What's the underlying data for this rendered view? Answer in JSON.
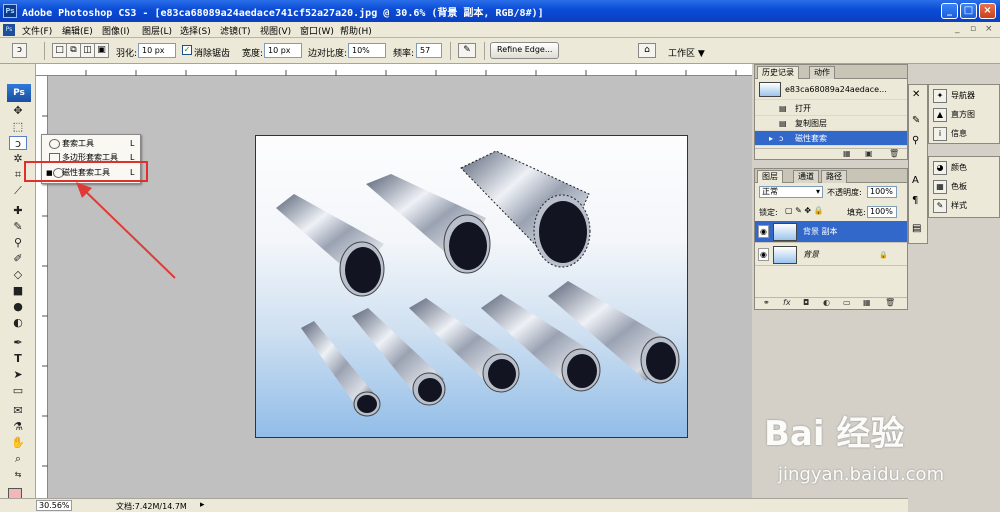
{
  "title": "Adobe Photoshop CS3 - [e83ca68089a24aedace741cf52a27a20.jpg @ 30.6% (背景 副本, RGB/8#)]",
  "ps_logo": "Ps",
  "menu": [
    "文件(F)",
    "编辑(E)",
    "图像(I)",
    "图层(L)",
    "选择(S)",
    "滤镜(T)",
    "视图(V)",
    "窗口(W)",
    "帮助(H)"
  ],
  "options": {
    "feather_label": "羽化:",
    "feather_value": "10 px",
    "antialias_label": "消除锯齿",
    "width_label": "宽度:",
    "width_value": "10 px",
    "contrast_label": "边对比度:",
    "contrast_value": "10%",
    "frequency_label": "频率:",
    "frequency_value": "57",
    "refine_edge": "Refine Edge...",
    "workspace": "工作区 ▼"
  },
  "flyout": [
    {
      "label": "套索工具",
      "shortcut": "L"
    },
    {
      "label": "多边形套索工具",
      "shortcut": "L"
    },
    {
      "label": "磁性套索工具",
      "shortcut": "L"
    }
  ],
  "history": {
    "tabs": [
      "历史记录",
      "动作"
    ],
    "snapshot": "e83ca68089a24aedace...",
    "items": [
      "打开",
      "复制图层",
      "磁性套索"
    ]
  },
  "layers": {
    "tabs": [
      "图层",
      "通道",
      "路径"
    ],
    "blend_mode": "正常",
    "opacity_label": "不透明度:",
    "opacity_value": "100%",
    "lock_label": "锁定:",
    "fill_label": "填充:",
    "fill_value": "100%",
    "items": [
      "背景 副本",
      "背景"
    ]
  },
  "dock": [
    "导航器",
    "直方图",
    "信息",
    "颜色",
    "色板",
    "样式"
  ],
  "status": {
    "zoom": "30.56%",
    "doc": "文档:7.42M/14.7M"
  },
  "watermark": {
    "logo": "Bai 经验",
    "url": "jingyan.baidu.com"
  }
}
